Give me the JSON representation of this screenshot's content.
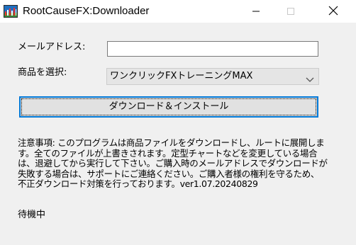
{
  "window": {
    "title": "RootCauseFX:Downloader",
    "icon": "fx-chart-icon",
    "controls": [
      "minimize-icon",
      "maximize-icon",
      "close-icon"
    ]
  },
  "form": {
    "email_label": "メールアドレス:",
    "email_value": "",
    "product_label": "商品を選択:",
    "product_selected": "ワンクリックFXトレーニングMAX",
    "download_button": "ダウンロード＆インストール"
  },
  "notes": [
    "注意事項: このプログラムは商品ファイルをダウンロードし、ルートに展開しま",
    "す。全てのファイルが上書きされます。定型チャートなどを変更している場合",
    "は、退避してから実行して下さい。ご購入時のメールアドレスでダウンロードが",
    "失敗する場合は、サポートにご連絡ください。ご購入者様の権利を守るため、",
    "不正ダウンロード対策を行っております。ver1.07.20240829"
  ],
  "status": "待機中",
  "colors": {
    "accent": "#0078d7",
    "window_bg": "#f0f0f0",
    "titlebar_bg": "#ffffff"
  }
}
